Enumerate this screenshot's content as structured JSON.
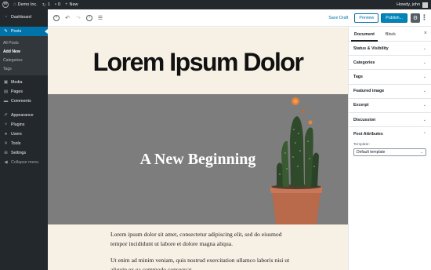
{
  "admin_bar": {
    "site_name": "Demo Inc.",
    "updates_count": "1",
    "comments_count": "0",
    "new_label": "New",
    "greeting": "Howdy, john"
  },
  "sidebar": {
    "dashboard": "Dashboard",
    "posts": "Posts",
    "posts_sub": [
      "All Posts",
      "Add New",
      "Categories",
      "Tags"
    ],
    "media": "Media",
    "pages": "Pages",
    "comments": "Comments",
    "appearance": "Appearance",
    "plugins": "Plugins",
    "users": "Users",
    "tools": "Tools",
    "settings": "Settings",
    "collapse": "Collapse menu"
  },
  "toolbar": {
    "save_draft": "Save Draft",
    "preview": "Preview",
    "publish": "Publish..."
  },
  "post": {
    "title": "Lorem Ipsum Dolor",
    "cover_text": "A New Beginning",
    "paragraph_1": "Lorem ipsum dolor sit amet, consectetur adipiscing elit, sed do eiusmod tempor incididunt ut labore et dolore magna aliqua.",
    "paragraph_2": "Ut enim ad minim veniam, quis nostrud exercitation ullamco laboris nisi ut aliquip ex ea commodo consequat."
  },
  "panel": {
    "tab_document": "Document",
    "tab_block": "Block",
    "sections": [
      "Status & Visibility",
      "Categories",
      "Tags",
      "Featured image",
      "Excerpt",
      "Discussion"
    ],
    "post_attributes": "Post Attributes",
    "template_label": "Template:",
    "template_value": "Default template"
  },
  "colors": {
    "admin_dark": "#23282d",
    "accent_blue": "#0073aa",
    "publish_blue": "#0085ba",
    "canvas_cream": "#f6f0e5",
    "cover_gray": "#7d7d7d"
  }
}
